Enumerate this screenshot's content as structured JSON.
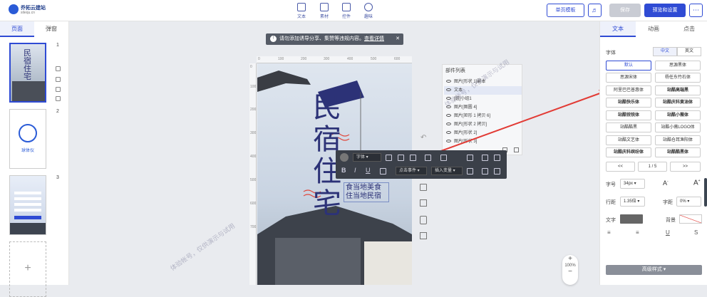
{
  "brand": {
    "name": "乔拓云建站",
    "url": "sitequ.cn"
  },
  "toolbar": {
    "tools": [
      {
        "label": "文本",
        "icon": "text-icon"
      },
      {
        "label": "素材",
        "icon": "image-icon"
      },
      {
        "label": "控件",
        "icon": "widget-icon"
      },
      {
        "label": "趣味",
        "icon": "fun-icon"
      }
    ],
    "single_template": "单页模板",
    "save": "保存",
    "preview_settings": "预览和设置"
  },
  "left_panel": {
    "tabs": [
      "页面",
      "弹窗"
    ],
    "pages": [
      "1",
      "2",
      "3"
    ],
    "page2_label": "球体仪"
  },
  "notice": {
    "text": "请勿添加诱导分享、集赞等违规内容。",
    "link": "查看详情"
  },
  "ruler": {
    "h_ticks": [
      "0",
      "100",
      "200",
      "300",
      "400",
      "500",
      "600"
    ],
    "v_ticks": [
      "0",
      "100",
      "200",
      "300",
      "400",
      "500",
      "600",
      "700"
    ]
  },
  "poster": {
    "title_chars": [
      "民",
      "宿",
      "住",
      "宅"
    ],
    "line1": "食当地美食",
    "line2": "住当地民宿"
  },
  "layers": {
    "title": "部件列表",
    "items": [
      "图片[形状 1]副本",
      "文本",
      "[组]小组1",
      "图片[图圆 4]",
      "图片[矩形 1 拷贝 6]",
      "图片[形状 2 拷贝]",
      "图片[形状 2]",
      "图片[形状 3]"
    ]
  },
  "float_toolbar": {
    "font": "字体",
    "event": "点击事件",
    "var": "插入变量"
  },
  "right_panel": {
    "tabs": [
      "文本",
      "动画",
      "点击"
    ],
    "font_label": "字体",
    "lang": [
      "中文",
      "英文"
    ],
    "fonts": [
      "默认",
      "思源黑体",
      "思源宋体",
      "杨任东竹石体",
      "阿里巴巴普惠体",
      "站酷高端黑",
      "站酷快乐体",
      "站酷庆科黄油体",
      "站酷锐锐体",
      "站酷小薇体",
      "站酷酷黑",
      "站酷小薇LOGO体",
      "站酷文艺体",
      "站酷仓耳渔阳体",
      "站酷庆科缤纷体",
      "站酷酷黑体"
    ],
    "pager": {
      "prev": "<<",
      "page": "1 / 5",
      "next": ">>"
    },
    "size_label": "字号",
    "size": "34px",
    "line_label": "行距",
    "line": "1.35倍",
    "spacing_label": "字距",
    "spacing": "0%",
    "color_label": "文字",
    "bg_label": "背景",
    "advanced": "高级样式"
  },
  "zoom": {
    "level": "100%"
  },
  "watermark": "体验帐号，仅供演示与试用",
  "colors": {
    "accent": "#2f4bd4",
    "arrow": "#e23b35",
    "poster_text": "#2c3277"
  }
}
